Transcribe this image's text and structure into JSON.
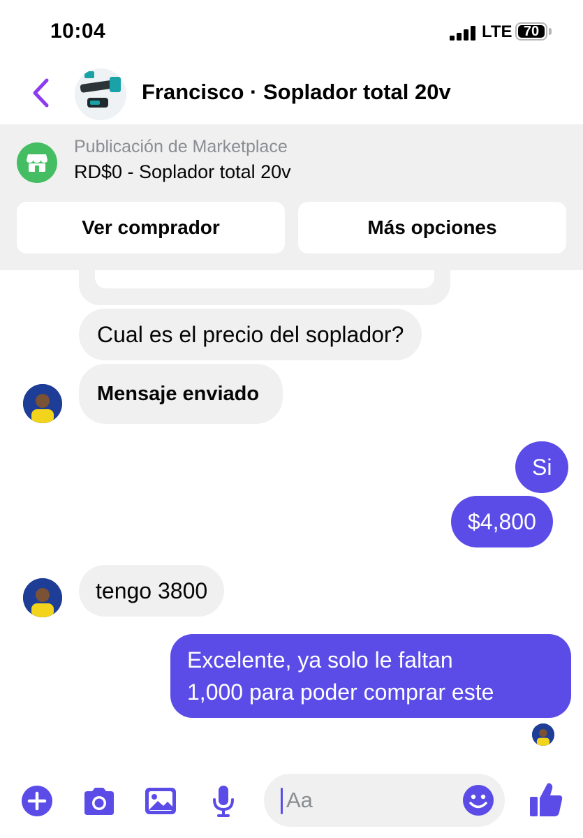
{
  "status_bar": {
    "time": "10:04",
    "network": "LTE",
    "battery": "70"
  },
  "header": {
    "title": "Francisco · Soplador total 20v"
  },
  "banner": {
    "subtitle": "Publicación de Marketplace",
    "listing": "RD$0 - Soplador total 20v",
    "buttons": [
      "Ver comprador",
      "Más opciones"
    ]
  },
  "messages": [
    {
      "from": "them",
      "text": "Cual es el precio del soplador?"
    },
    {
      "from": "them",
      "text": "Mensaje enviado"
    },
    {
      "from": "me",
      "text": "Si"
    },
    {
      "from": "me",
      "text": "$4,800"
    },
    {
      "from": "them",
      "text": "tengo 3800"
    },
    {
      "from": "me",
      "lines": [
        "Excelente, ya solo le faltan",
        "1,000 para poder comprar este"
      ]
    }
  ],
  "composer": {
    "placeholder": "Aa"
  },
  "colors": {
    "accent": "#5b4ce8",
    "incoming_bubble": "#f0f0f0",
    "marketplace_green": "#45bd62",
    "back_purple": "#8b3cf0"
  }
}
